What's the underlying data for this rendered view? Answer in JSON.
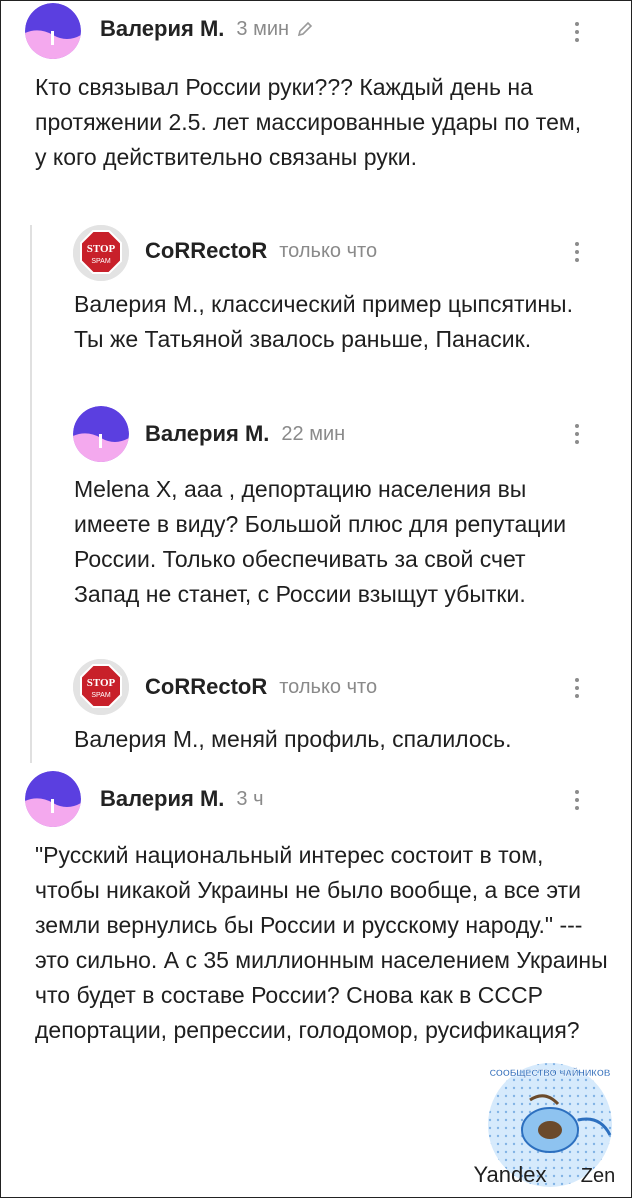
{
  "comments": [
    {
      "author": "Валерия М.",
      "time": "3 мин",
      "edited": true,
      "avatar": "purple-pink-avatar-icon",
      "text": "Кто связывал России руки??? Каждый день на протяжении 2.5. лет массированные удары по тем, у кого действительно связаны руки."
    },
    {
      "author": "CoRRectoR",
      "time": "только что",
      "avatar": "stop-spam-avatar-icon",
      "text": "Валерия М., классический пример цыпсятины. Ты же Татьяной звалось раньше, Панасик."
    },
    {
      "author": "Валерия М.",
      "time": "22 мин",
      "avatar": "purple-pink-avatar-icon",
      "text": "Melena X, ааа , депортацию населения вы имеете в виду? Большой плюс для репутации России. Только обеспечивать за свой счет Запад не станет, с России взыщут убытки."
    },
    {
      "author": "CoRRectoR",
      "time": "только что",
      "avatar": "stop-spam-avatar-icon",
      "text": "Валерия М., меняй профиль, спалилось."
    },
    {
      "author": "Валерия М.",
      "time": "3 ч",
      "avatar": "purple-pink-avatar-icon",
      "text": "\"Русский национальный интерес состоит в том, чтобы никакой Украины не было вообще, а все эти земли вернулись бы России и русскому народу.\" --- это сильно. А с 35 миллионным населением Украины что будет в составе России? Снова как в СССР депортации, репрессии, голодомор, русификация?"
    }
  ],
  "stop_badge": {
    "line1": "STOP",
    "line2": "SPAM"
  },
  "watermark": {
    "community": "СООБЩЕСТВО ЧАЙНИКОВ",
    "brand1": "Yandex",
    "brand2": "Zen"
  },
  "colors": {
    "avatar_purple": "#5b3fe0",
    "avatar_pink": "#f4a9ee",
    "stop_red": "#c8202a",
    "meta_gray": "#8a8a8a"
  }
}
